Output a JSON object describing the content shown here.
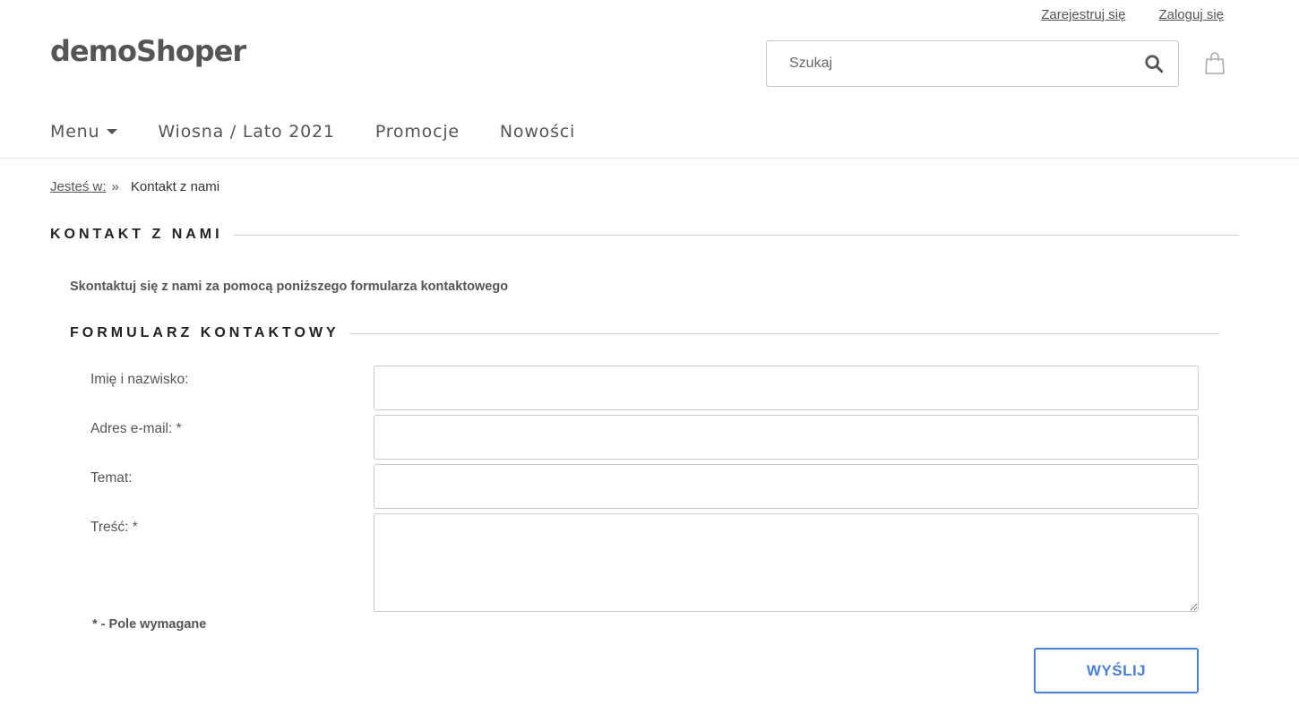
{
  "header": {
    "logo": "demoShoper",
    "top_links": {
      "register": "Zarejestruj się",
      "login": "Zaloguj się"
    },
    "search": {
      "placeholder": "Szukaj"
    }
  },
  "nav": {
    "menu": "Menu",
    "items": [
      "Wiosna / Lato 2021",
      "Promocje",
      "Nowości"
    ]
  },
  "breadcrumb": {
    "prefix": "Jesteś w:",
    "separator": "»",
    "current": "Kontakt z nami"
  },
  "page": {
    "title": "KONTAKT Z NAMI",
    "intro": "Skontaktuj się z nami za pomocą poniższego formularza kontaktowego"
  },
  "form": {
    "title": "FORMULARZ KONTAKTOWY",
    "fields": {
      "name": {
        "label": "Imię i nazwisko:",
        "value": ""
      },
      "email": {
        "label": "Adres e-mail: *",
        "value": ""
      },
      "subject": {
        "label": "Temat:",
        "value": ""
      },
      "message": {
        "label": "Treść: *",
        "value": ""
      }
    },
    "required_note": "* - Pole wymagane",
    "submit_label": "WYŚLIJ"
  },
  "colors": {
    "accent": "#4a7fd6",
    "text": "#555555",
    "heading": "#222222"
  }
}
